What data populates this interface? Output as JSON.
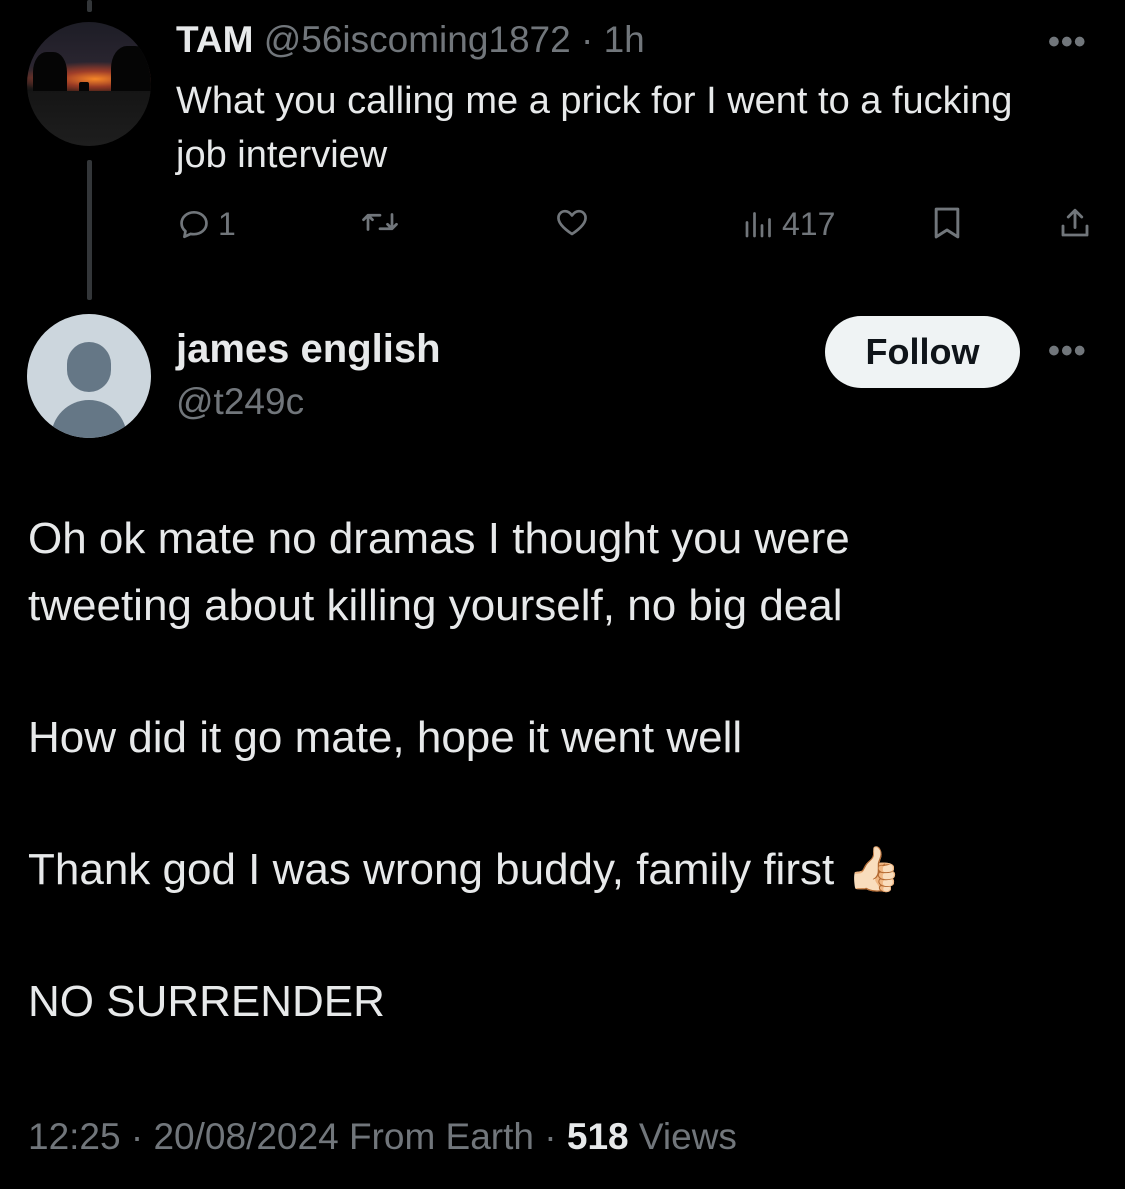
{
  "parent_tweet": {
    "display_name": "TAM",
    "handle": "@56iscoming1872",
    "separator": "·",
    "time_ago": "1h",
    "text": "What you calling me a prick for I went to a fucking job interview",
    "replies_count": "1",
    "views_count": "417",
    "more_label": "•••"
  },
  "main_tweet": {
    "display_name": "james english",
    "handle": "@t249c",
    "follow_label": "Follow",
    "more_label": "•••",
    "lines": [
      "Oh ok mate no dramas I thought you were",
      "tweeting about killing yourself, no big deal",
      "How did it go mate, hope it went well",
      "Thank god I was wrong buddy, family first",
      "NO SURRENDER"
    ],
    "emoji": "👍🏻",
    "time": "12:25",
    "separator": "·",
    "date": "20/08/2024",
    "source": "From Earth",
    "views_count": "518",
    "views_label": "Views"
  },
  "colors": {
    "background": "#000000",
    "text_primary": "#e7e9ea",
    "text_muted": "#71767b",
    "follow_button_bg": "#eff3f4",
    "default_avatar_bg": "#ccd6dd",
    "default_avatar_fg": "#657786"
  },
  "icons": {
    "reply": "reply-icon",
    "retweet": "retweet-icon",
    "like": "heart-icon",
    "views": "views-icon",
    "bookmark": "bookmark-icon",
    "share": "share-icon",
    "more": "more-icon",
    "thumbs_up": "thumbs-up-emoji"
  }
}
